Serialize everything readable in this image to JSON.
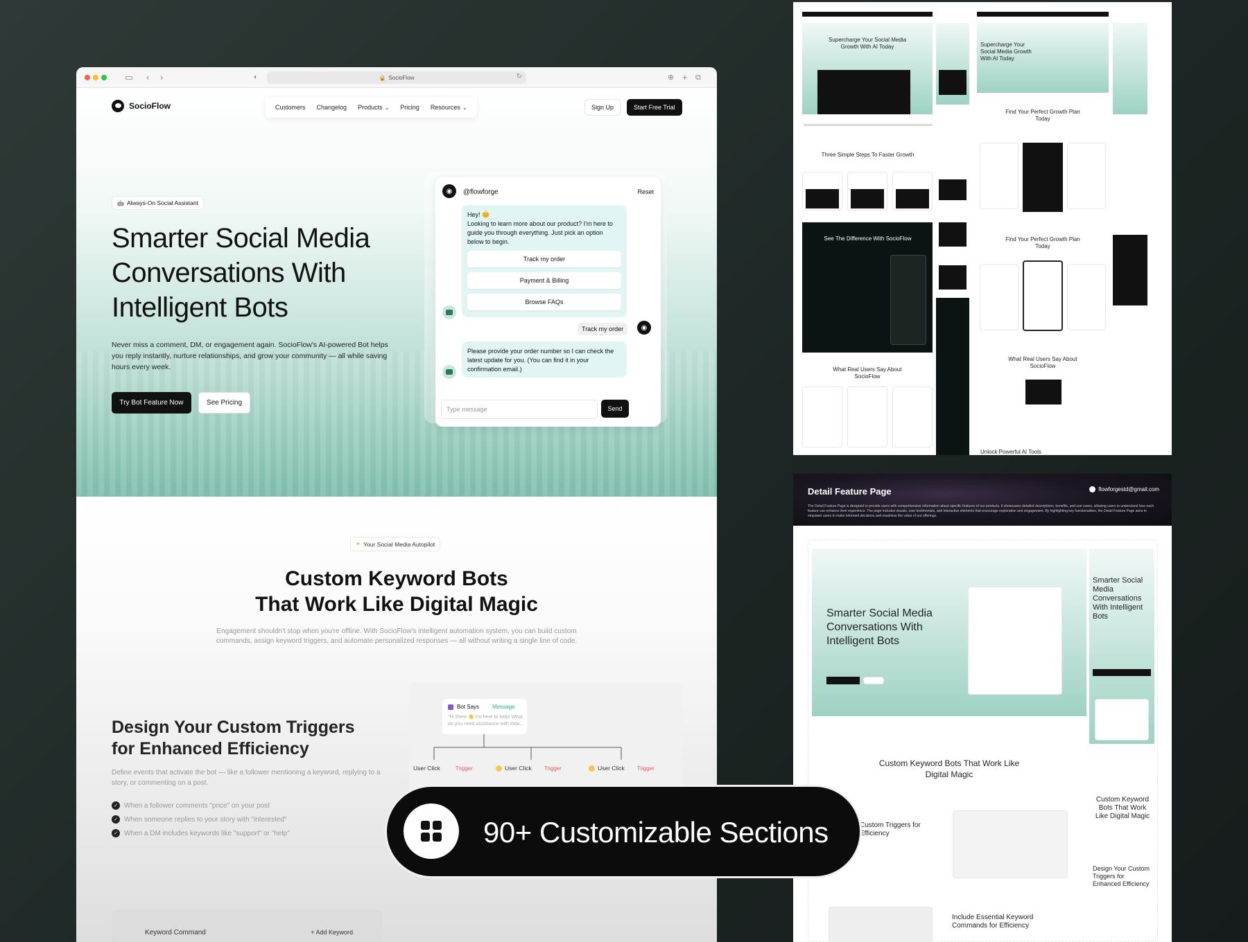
{
  "browser": {
    "url": "SocioFlow"
  },
  "nav": {
    "logo": "SocioFlow",
    "links": [
      "Customers",
      "Changelog",
      "Products",
      "Pricing",
      "Resources"
    ],
    "signup": "Sign Up",
    "trial": "Start Free Trial"
  },
  "hero": {
    "badge": "Always-On Social Assistant",
    "title": "Smarter Social Media Conversations With Intelligent Bots",
    "description": "Never miss a comment, DM, or engagement again. SocioFlow's AI-powered Bot helps you reply instantly, nurture relationships, and grow your community — all while saving hours every week.",
    "cta_primary": "Try Bot Feature Now",
    "cta_secondary": "See Pricing"
  },
  "chat": {
    "handle": "@flowforge",
    "reset": "Reset",
    "greeting_line1": "Hey! 😊",
    "greeting_line2": "Looking to learn more about our product? I'm here to guide you through everything. Just pick an option below to begin.",
    "options": [
      "Track my order",
      "Payment & Billing",
      "Browse FAQs"
    ],
    "user_message": "Track my order",
    "bot_reply": "Please provide your order number so I can check the latest update for you. (You can find it in your confirmation email.)",
    "input_placeholder": "Type message",
    "send": "Send"
  },
  "section2": {
    "badge": "Your Social Media Autopilot",
    "title_line1": "Custom Keyword Bots",
    "title_line2": "That Work Like Digital Magic",
    "description": "Engagement shouldn't stop when you're offline. With SocioFlow's intelligent automation system, you can build custom commands, assign keyword triggers, and automate personalized responses — all without writing a single line of code.",
    "triggers_title": "Design Your Custom Triggers for Enhanced Efficiency",
    "triggers_desc": "Define events that activate the bot — like a follower mentioning a keyword, replying to a story, or commenting on a post.",
    "checks": [
      "When a follower comments \"price\" on your post",
      "When someone replies to your story with \"interested\"",
      "When a DM includes keywords like \"support\" or \"help\""
    ],
    "flow": {
      "bot_says": "Bot Says",
      "message_tag": "Message",
      "bot_text": "\"Hi there 👋 I'm here to help! What do you need assistance with toda...",
      "node_label": "User Click",
      "trigger_label": "Trigger"
    },
    "keyword_card": {
      "title": "Keyword Command",
      "add": "+ Add Keyword"
    }
  },
  "thumbnails": {
    "t1_hero": "Supercharge Your Social Media Growth With AI Today",
    "t1_steps": "Three Simple Steps To Faster Growth",
    "t1_diff": "See The Difference With SocioFlow",
    "t1_users": "What Real Users Say About SocioFlow",
    "t1_pricing": "Find Your Perfect Growth Plan Today",
    "t1_tools": "Unlock Powerful AI Tools",
    "t2_header": "Detail Feature Page",
    "t2_email": "flowforgestd@gmail.com",
    "t2_desc": "The Detail Feature Page is designed to provide users with comprehensive information about specific features of our products. It showcases detailed descriptions, benefits, and use cases, allowing users to understand how each feature can enhance their experience. The page includes visuals, user testimonials, and interactive elements that encourage exploration and engagement. By highlighting key functionalities, the Detail Feature Page aims to empower users to make informed decisions and maximize the value of our offerings.",
    "t2_hero": "Smarter Social Media Conversations With Intelligent Bots",
    "t2_kw": "Custom Keyword Bots That Work Like Digital Magic",
    "t2_triggers": "Custom Triggers for Efficiency",
    "t2_essential": "Include Essential Keyword Commands for Efficiency",
    "t2_mobile_hero": "Smarter Social Media Conversations With Intelligent Bots",
    "t2_mobile_kw": "Custom Keyword Bots That Work Like Digital Magic",
    "t2_mobile_triggers": "Design Your Custom Triggers for Enhanced Efficiency"
  },
  "banner": {
    "text": "90+ Customizable Sections",
    "icon": "grid-icon"
  }
}
